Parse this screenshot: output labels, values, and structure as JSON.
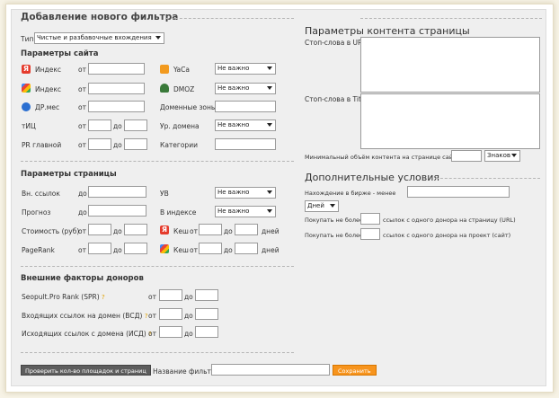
{
  "title": "Добавление нового фильтра",
  "type_row": {
    "label": "Тип",
    "value": "Чистые и разбавочные вхождения"
  },
  "site_params": {
    "heading": "Параметры сайта",
    "yandex_label": "Индекс",
    "google_label": "Индекс",
    "dpmes_label": "ДР.мес",
    "tic_label": "тИЦ",
    "pr_label": "PR главной",
    "from": "от",
    "to": "до",
    "yaca_label": "YaCa",
    "yaca_value": "Не важно",
    "dmoz_label": "DMOZ",
    "dmoz_value": "Не важно",
    "domain_zones_label": "Доменные зоны",
    "domain_level_label": "Ур. домена",
    "domain_level_value": "Не важно",
    "categories_label": "Категории"
  },
  "page_params": {
    "heading": "Параметры страницы",
    "ext_links_label": "Вн. ссылок",
    "forecast_label": "Прогноз",
    "cost_label": "Стоимость (руб)",
    "pagerank_label": "PageRank",
    "to": "до",
    "from": "от",
    "uv_label": "УВ",
    "uv_value": "Не важно",
    "in_index_label": "В индексе",
    "in_index_value": "Не важно",
    "cache_label": "Кеш",
    "days": "дней"
  },
  "donor_factors": {
    "heading": "Внешние факторы доноров",
    "spr_label": "Seopult.Pro Rank (SPR)",
    "vsd_label": "Входящих ссылок на домен (ВСД)",
    "isd_label": "Исходящих ссылок с домена (ИСД)",
    "q": "?",
    "from": "от",
    "to": "до"
  },
  "content_params": {
    "heading": "Параметры контента страницы",
    "stopwords_url_label": "Стоп-слова в URL",
    "stopwords_title_label": "Стоп-слова в Title",
    "min_content_label": "Минимальный объём контента на странице сайта",
    "unit_value": "Знаков"
  },
  "extra_conditions": {
    "heading": "Дополнительные условия",
    "exchange_label": "Нахождение в бирже - менее",
    "days_value": "Дней",
    "buy_page_prefix": "Покупать не более",
    "buy_page_suffix": "ссылок с одного донора на страницу (URL)",
    "buy_project_prefix": "Покупать не более",
    "buy_project_suffix": "ссылок с одного донора на проект (сайт)"
  },
  "footer": {
    "check_button": "Проверить кол-во площадок и страниц",
    "filter_name_label": "Название фильтра",
    "save_button": "Сохранить"
  },
  "colors": {
    "accent": "#f7941d",
    "panel": "#efefef",
    "button_dark": "#5d5d5d"
  }
}
